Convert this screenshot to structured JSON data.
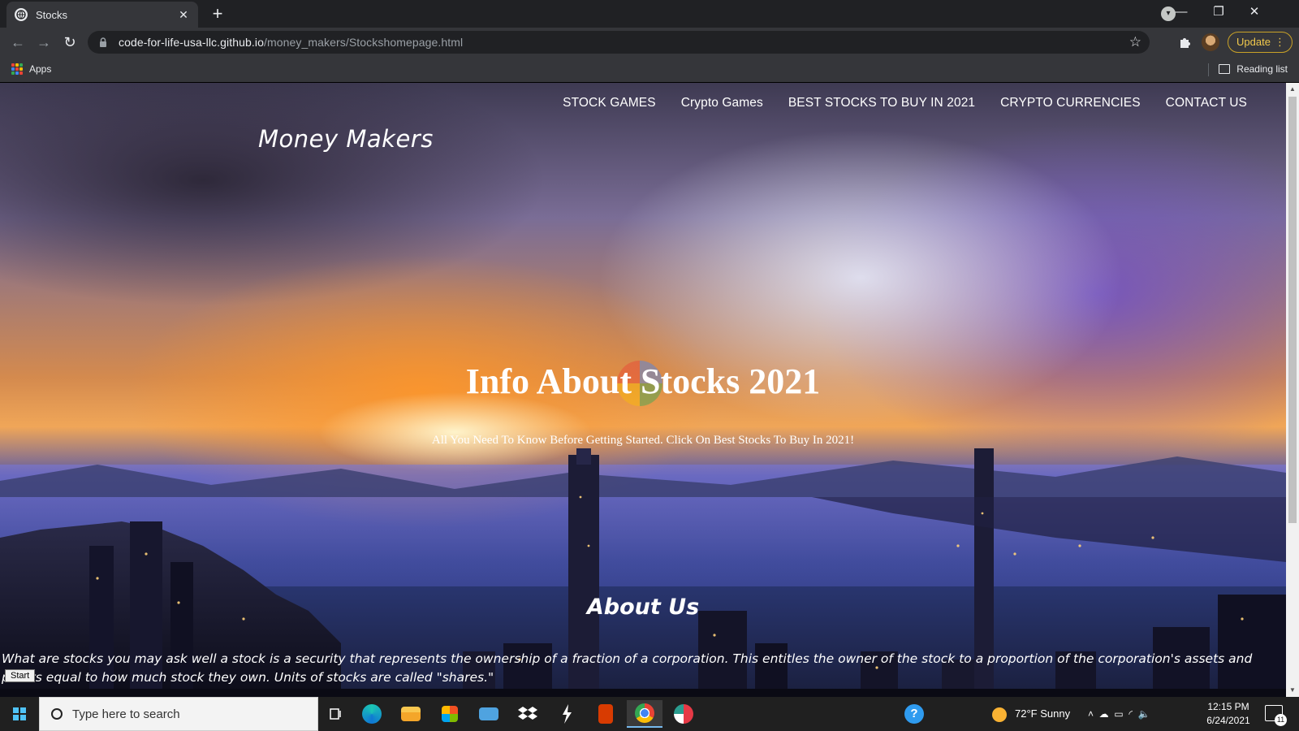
{
  "browser": {
    "tab_title": "Stocks",
    "url_host": "code-for-life-usa-llc.github.io",
    "url_path": "/money_makers/Stockshomepage.html",
    "update_label": "Update",
    "bookmarks": {
      "apps_label": "Apps",
      "reading_list_label": "Reading list"
    }
  },
  "page": {
    "nav": [
      {
        "label": "STOCK GAMES"
      },
      {
        "label": "Crypto Games"
      },
      {
        "label": "BEST STOCKS TO BUY IN 2021"
      },
      {
        "label": "CRYPTO CURRENCIES"
      },
      {
        "label": "CONTACT US"
      }
    ],
    "brand": "Money Makers",
    "hero_title": "Info About Stocks 2021",
    "hero_subtitle": "All You Need To Know Before Getting Started. Click On Best Stocks To Buy In 2021!",
    "about_title": "About Us",
    "about_text": "What are stocks you may ask well a stock is a security that represents the ownership of a fraction of a corporation. This entitles the owner of the stock to a proportion of the corporation's assets and profits equal to how much stock they own. Units of stocks are called \"shares.\""
  },
  "taskbar": {
    "start_tooltip": "Start",
    "search_placeholder": "Type here to search",
    "weather": "72°F  Sunny",
    "time": "12:15 PM",
    "date": "6/24/2021",
    "notification_count": "11"
  },
  "colors": {
    "chrome_dark": "#202124",
    "chrome_toolbar": "#35363a",
    "update_accent": "#f2c94c",
    "taskbar": "#202020"
  },
  "icons": [
    "globe-icon",
    "lock-icon",
    "star-icon",
    "puzzle-icon",
    "apps-grid-icon",
    "reading-list-icon",
    "windows-logo-icon",
    "search-icon",
    "task-view-icon",
    "edge-icon",
    "file-explorer-icon",
    "store-icon",
    "mail-icon",
    "dropbox-icon",
    "app-icon",
    "office-icon",
    "chrome-icon",
    "help-icon",
    "weather-sun-icon",
    "notification-icon"
  ]
}
